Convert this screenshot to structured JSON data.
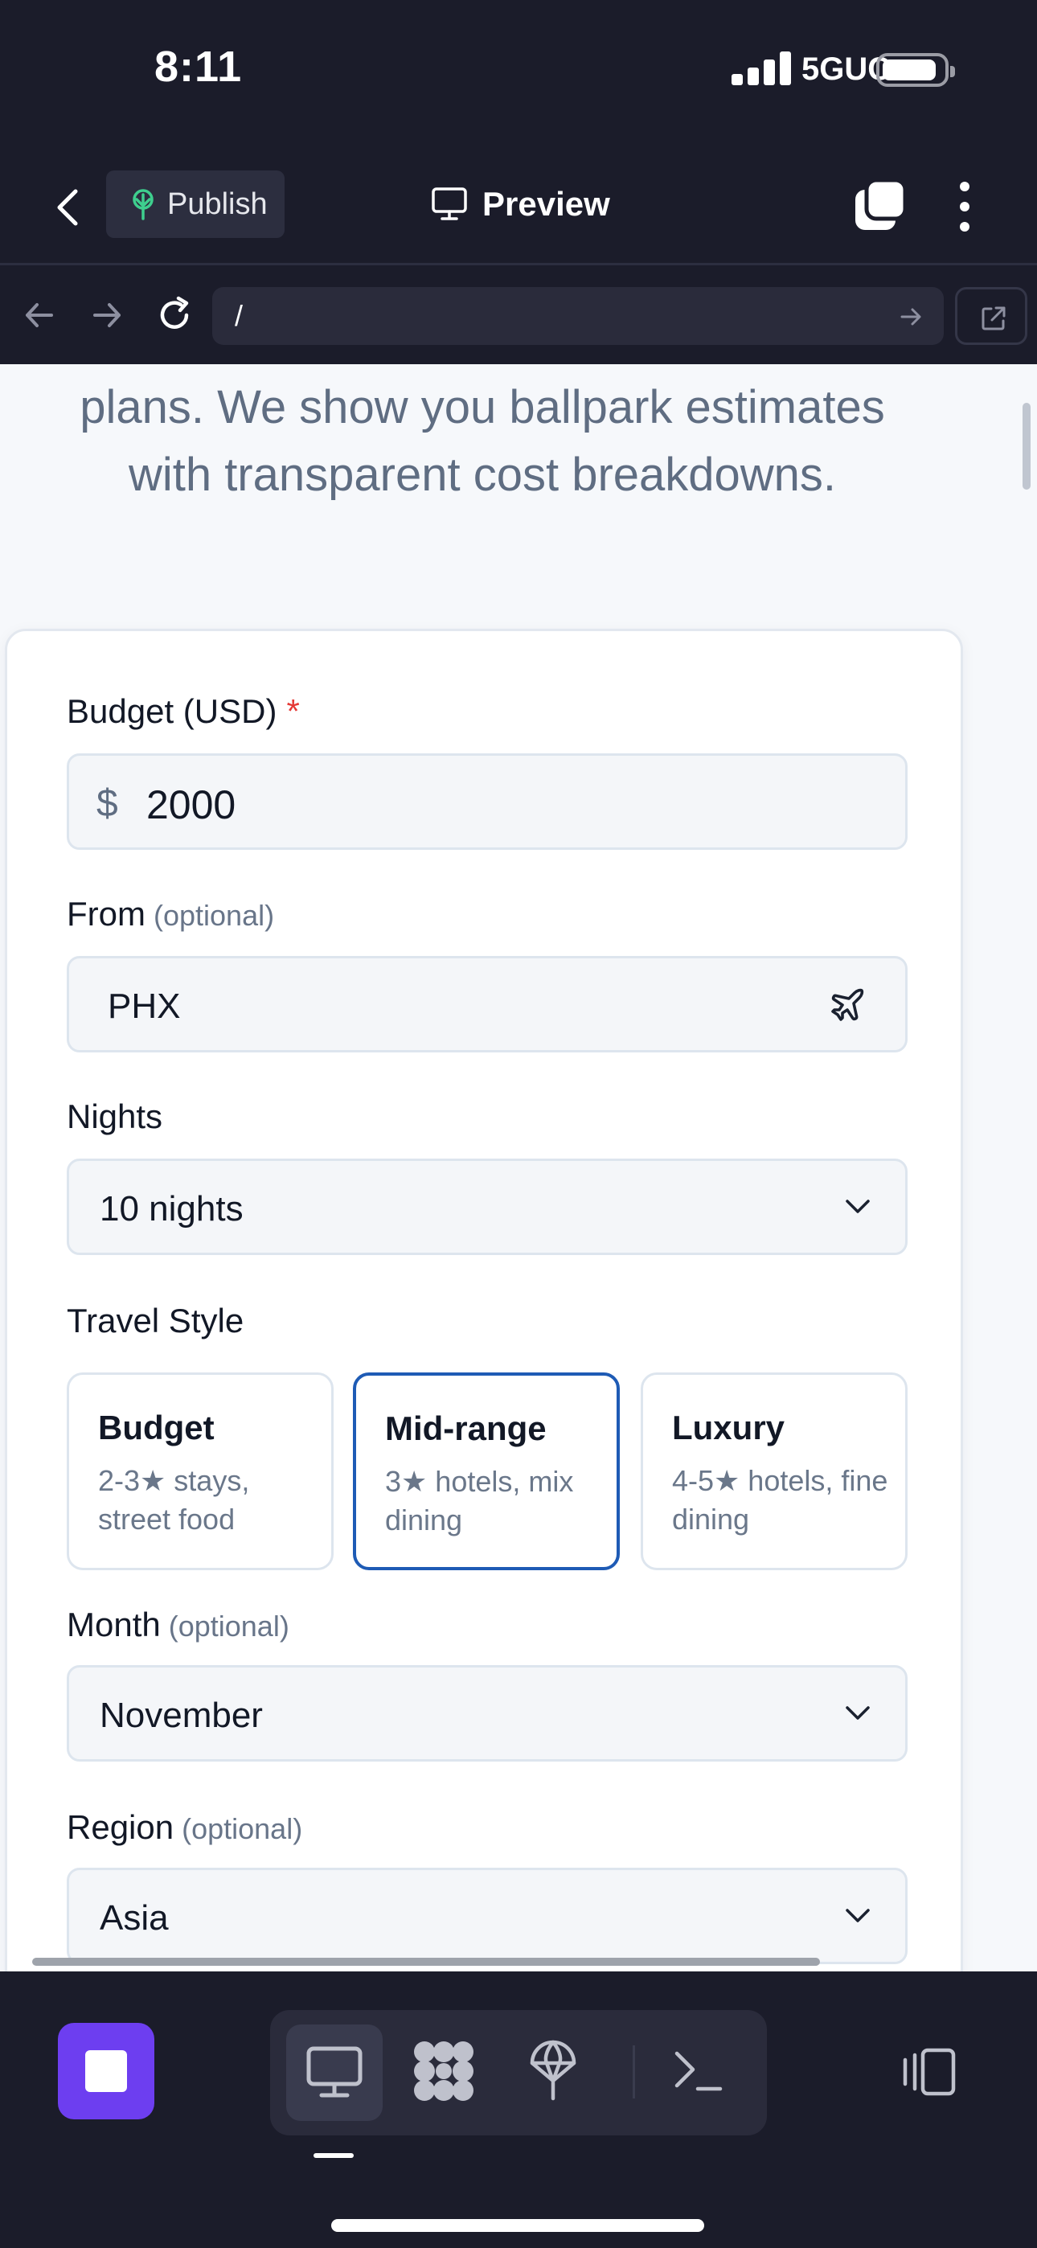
{
  "status_bar": {
    "time": "8:11",
    "network": "5GUC"
  },
  "toolbar": {
    "publish_label": "Publish",
    "preview_label": "Preview"
  },
  "url_bar": {
    "url": "/"
  },
  "page": {
    "intro_line1": "plans. We show you ballpark estimates",
    "intro_line2": "with transparent cost breakdowns.",
    "form": {
      "budget": {
        "label": "Budget (USD)",
        "required_mark": "*",
        "currency_symbol": "$",
        "value": "2000"
      },
      "from": {
        "label": "From",
        "optional": "(optional)",
        "value": "PHX"
      },
      "nights": {
        "label": "Nights",
        "value": "10 nights"
      },
      "travel_style": {
        "label": "Travel Style",
        "options": [
          {
            "title": "Budget",
            "desc": "2-3★ stays, street food",
            "selected": false
          },
          {
            "title": "Mid-range",
            "desc": "3★ hotels, mix dining",
            "selected": true
          },
          {
            "title": "Luxury",
            "desc": "4-5★ hotels, fine dining",
            "selected": false
          }
        ]
      },
      "month": {
        "label": "Month",
        "optional": "(optional)",
        "value": "November"
      },
      "region": {
        "label": "Region",
        "optional": "(optional)",
        "value": "Asia"
      }
    }
  },
  "colors": {
    "accent": "#1e5bb5",
    "stop_button": "#6d3ef0",
    "required": "#e53935",
    "publish_icon": "#3ecf8e"
  },
  "icons": [
    "back-chevron-icon",
    "publish-tree-icon",
    "monitor-icon",
    "tabs-icon",
    "more-vertical-icon",
    "arrow-left-icon",
    "arrow-right-icon",
    "reload-icon",
    "open-external-icon",
    "plane-icon",
    "chevron-down-icon",
    "stop-icon",
    "desktop-icon",
    "modules-icon",
    "deploy-icon",
    "terminal-icon",
    "layout-toggle-icon"
  ]
}
